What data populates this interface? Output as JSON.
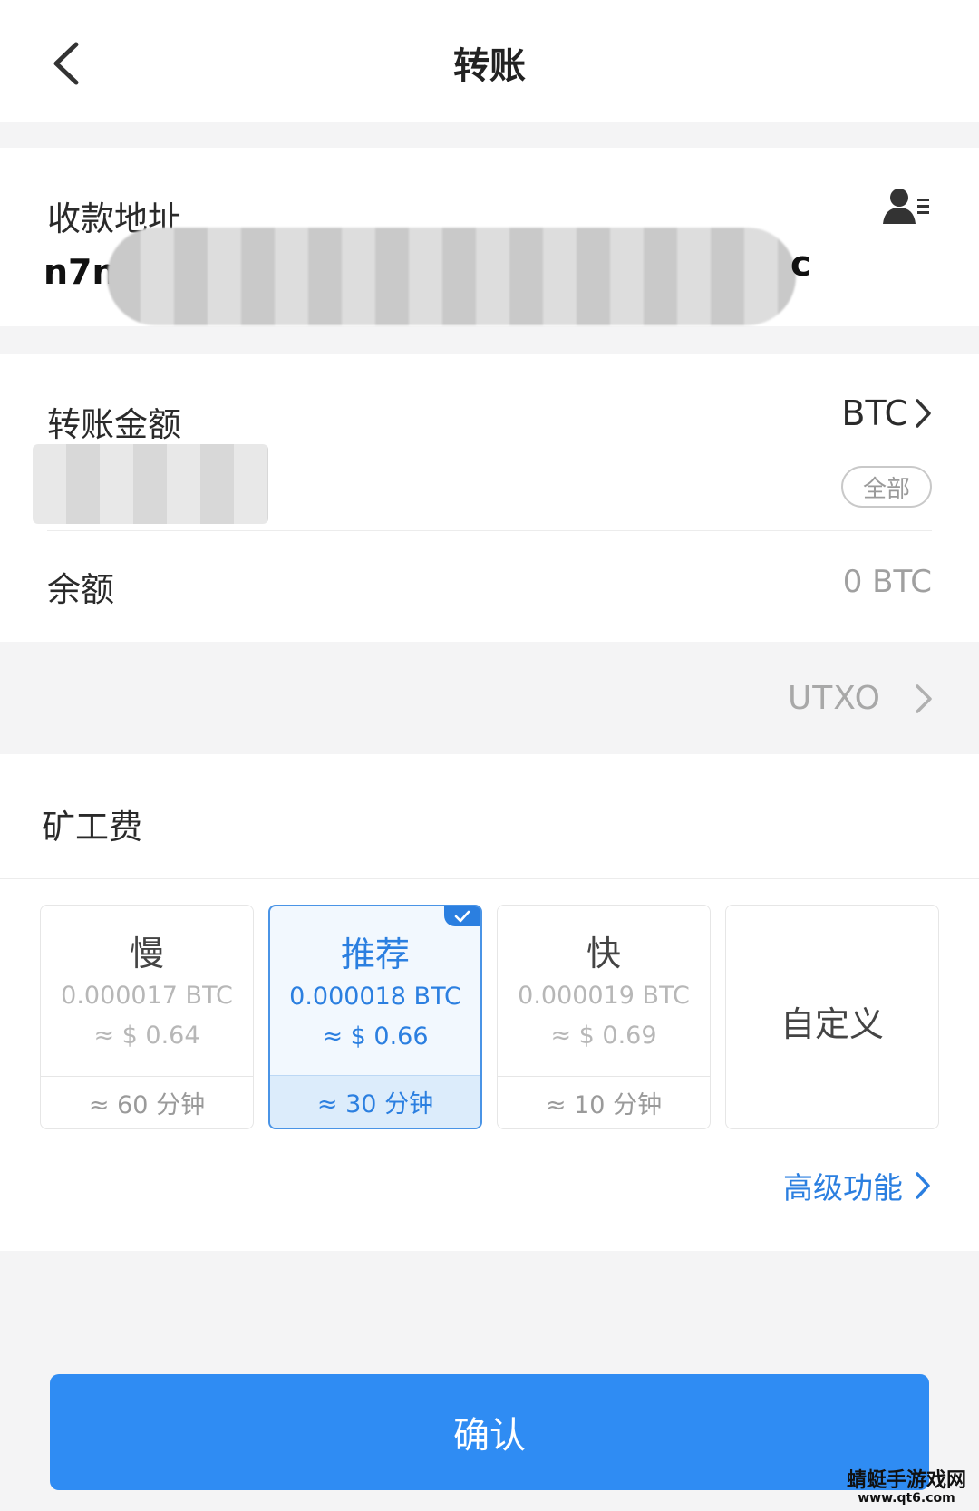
{
  "header": {
    "title": "转账"
  },
  "address": {
    "label": "收款地址",
    "value_start": "n7n",
    "value_end": "c"
  },
  "amount": {
    "label": "转账金额",
    "coin": "BTC",
    "all_label": "全部",
    "balance_label": "余额",
    "balance_value": "0 BTC"
  },
  "utxo": {
    "label": "UTXO"
  },
  "fee": {
    "title": "矿工费",
    "options": [
      {
        "name": "慢",
        "btc": "0.000017 BTC",
        "usd": "≈ $ 0.64",
        "time": "≈ 60 分钟",
        "selected": false
      },
      {
        "name": "推荐",
        "btc": "0.000018 BTC",
        "usd": "≈ $ 0.66",
        "time": "≈ 30 分钟",
        "selected": true
      },
      {
        "name": "快",
        "btc": "0.000019 BTC",
        "usd": "≈ $ 0.69",
        "time": "≈ 10 分钟",
        "selected": false
      },
      {
        "name": "自定义"
      }
    ],
    "advanced_label": "高级功能"
  },
  "confirm": {
    "label": "确认"
  },
  "watermark": {
    "line1": "蜻蜓手游戏网",
    "line2": "www.qt6.com"
  },
  "colors": {
    "accent": "#2f8cf3",
    "selected_text": "#2b7fe0",
    "muted": "#b7b7b7"
  },
  "icons": {
    "back": "chevron-left-icon",
    "contacts": "contacts-icon",
    "chevron": "chevron-right-icon",
    "check": "check-icon"
  }
}
